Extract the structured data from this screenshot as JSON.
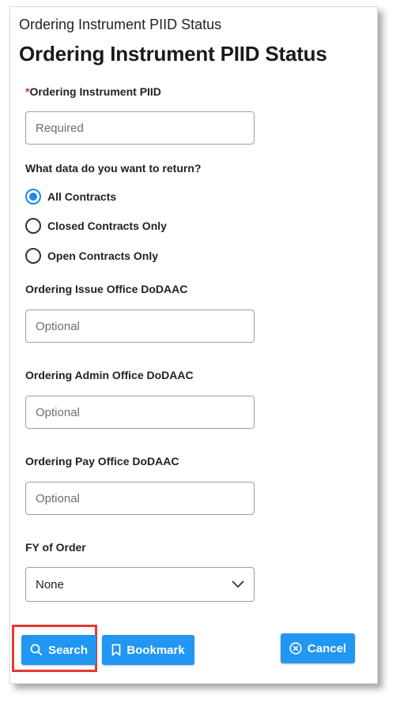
{
  "header": {
    "small_title": "Ordering Instrument PIID Status",
    "title": "Ordering Instrument PIID Status"
  },
  "form": {
    "piid": {
      "required_mark": "*",
      "label": "Ordering Instrument PIID",
      "placeholder": "Required",
      "value": ""
    },
    "return_data": {
      "question": "What data do you want to return?",
      "options": [
        {
          "label": "All Contracts",
          "checked": true
        },
        {
          "label": "Closed Contracts Only",
          "checked": false
        },
        {
          "label": "Open Contracts Only",
          "checked": false
        }
      ]
    },
    "issue_office": {
      "label": "Ordering Issue Office DoDAAC",
      "placeholder": "Optional",
      "value": ""
    },
    "admin_office": {
      "label": "Ordering Admin Office DoDAAC",
      "placeholder": "Optional",
      "value": ""
    },
    "pay_office": {
      "label": "Ordering Pay Office DoDAAC",
      "placeholder": "Optional",
      "value": ""
    },
    "fy": {
      "label": "FY of Order",
      "selected": "None"
    }
  },
  "actions": {
    "search_label": "Search",
    "bookmark_label": "Bookmark",
    "cancel_label": "Cancel"
  },
  "colors": {
    "accent": "#2196f3",
    "required": "#d32f2f",
    "highlight": "#e53935"
  },
  "icons": {
    "search": "search-icon",
    "bookmark": "bookmark-icon",
    "cancel": "cancel-circle-icon",
    "dropdown": "chevron-down-icon"
  }
}
